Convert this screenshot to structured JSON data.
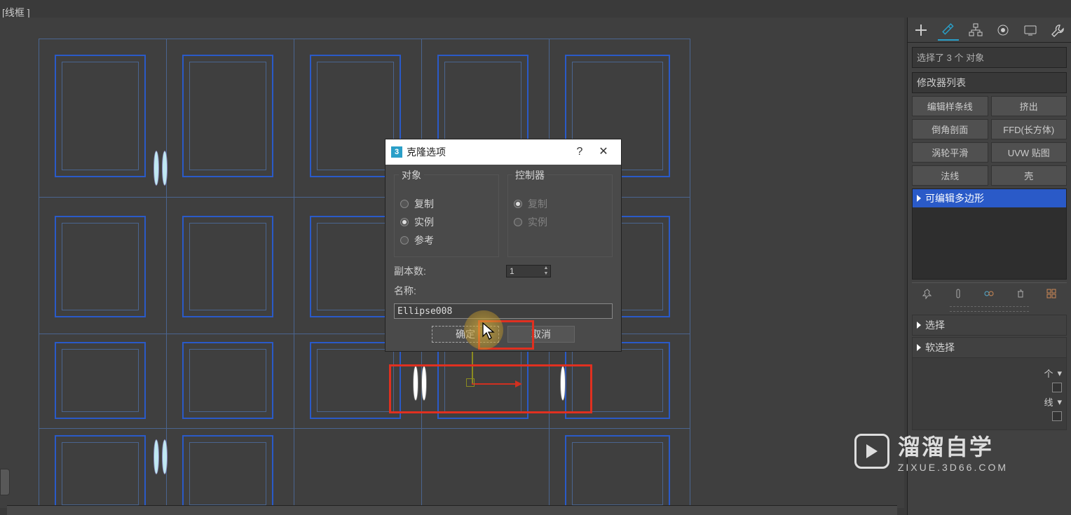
{
  "viewport": {
    "label": "[线框 ]"
  },
  "dialog": {
    "title": "克隆选项",
    "group_object": "对象",
    "group_controller": "控制器",
    "radio_copy": "复制",
    "radio_instance": "实例",
    "radio_reference": "参考",
    "ctrl_copy": "复制",
    "ctrl_instance": "实例",
    "copies_label": "副本数:",
    "copies_value": "1",
    "name_label": "名称:",
    "name_value": "Ellipse008",
    "btn_ok": "确定",
    "btn_cancel": "取消"
  },
  "cmd": {
    "selection_info": "选择了 3 个 对象",
    "modifier_list": "修改器列表",
    "btns": {
      "editspline": "编辑样条线",
      "extrude": "挤出",
      "chamferprof": "倒角剖面",
      "ffdbox": "FFD(长方体)",
      "turbosmooth": "涡轮平滑",
      "uvwmap": "UVW 贴图",
      "normal": "法线",
      "shell": "壳"
    },
    "stack_item": "可编辑多边形",
    "rollout_select": "选择",
    "rollout_softsel": "软选择",
    "row_obj_suffix": "个",
    "row_line_suffix": "线"
  },
  "watermark": {
    "big": "溜溜自学",
    "small": "ZIXUE.3D66.COM"
  }
}
